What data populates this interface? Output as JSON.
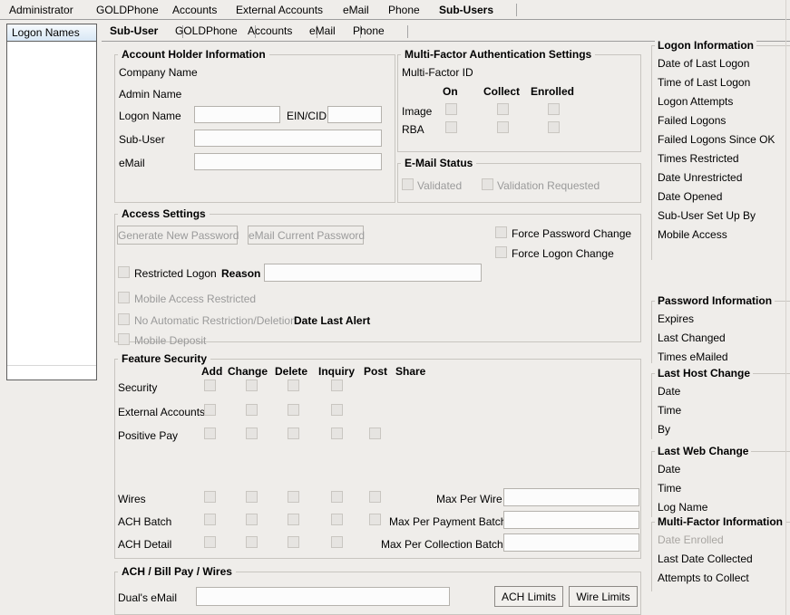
{
  "window": {
    "background_color": "#efedea",
    "accent_color": "#d8e7f5"
  },
  "top_tabs": [
    {
      "label": "Administrator",
      "selected": false
    },
    {
      "label": "GOLDPhone",
      "selected": false
    },
    {
      "label": "Accounts",
      "selected": false
    },
    {
      "label": "External Accounts",
      "selected": false
    },
    {
      "label": "eMail",
      "selected": false
    },
    {
      "label": "Phone",
      "selected": false
    },
    {
      "label": "Sub-Users",
      "selected": true
    }
  ],
  "sub_tabs": [
    {
      "label": "Sub-User",
      "selected": true
    },
    {
      "label": "GOLDPhone",
      "selected": false
    },
    {
      "label": "Accounts",
      "selected": false
    },
    {
      "label": "eMail",
      "selected": false
    },
    {
      "label": "Phone",
      "selected": false
    }
  ],
  "logon_list": {
    "header": "Logon Names",
    "rows": [
      "",
      "",
      "",
      "",
      "",
      "",
      "",
      "",
      "",
      "",
      "",
      "",
      "",
      "",
      "",
      "",
      "",
      "",
      "",
      "",
      ""
    ]
  },
  "account_holder": {
    "title": "Account Holder Information",
    "company_name_label": "Company Name",
    "company_name_value": "",
    "admin_name_label": "Admin Name",
    "admin_name_value": "",
    "logon_name_label": "Logon Name",
    "logon_name_value": "",
    "ein_cid_label": "EIN/CID",
    "ein_cid_value": "",
    "sub_user_label": "Sub-User",
    "sub_user_value": "",
    "email_label": "eMail",
    "email_value": ""
  },
  "mfa": {
    "title": "Multi-Factor Authentication Settings",
    "multi_factor_id_label": "Multi-Factor ID",
    "multi_factor_id_value": "",
    "columns": [
      "On",
      "Collect",
      "Enrolled"
    ],
    "rows": [
      {
        "label": "Image",
        "on": false,
        "collect": false,
        "enrolled": false
      },
      {
        "label": "RBA",
        "on": false,
        "collect": false,
        "enrolled": false
      }
    ]
  },
  "email_status": {
    "title": "E-Mail Status",
    "validated_label": "Validated",
    "validated_checked": false,
    "validation_requested_label": "Validation Requested",
    "validation_requested_checked": false
  },
  "access_settings": {
    "title": "Access Settings",
    "generate_password_button": "Generate New Password",
    "email_password_button": "eMail Current Password",
    "force_password_change_label": "Force Password Change",
    "force_password_change_checked": false,
    "force_logon_change_label": "Force Logon Change",
    "force_logon_change_checked": false,
    "restricted_logon_label": "Restricted Logon",
    "restricted_logon_checked": false,
    "reason_label": "Reason",
    "reason_value": "",
    "mobile_access_restricted_label": "Mobile Access Restricted",
    "mobile_access_restricted_checked": false,
    "no_auto_restriction_label": "No Automatic Restriction/Deletion",
    "no_auto_restriction_checked": false,
    "date_last_alert_label": "Date Last Alert",
    "date_last_alert_value": "",
    "mobile_deposit_label": "Mobile Deposit",
    "mobile_deposit_checked": false
  },
  "feature_security": {
    "title": "Feature Security",
    "columns": [
      "Add",
      "Change",
      "Delete",
      "Inquiry",
      "Post",
      "Share"
    ],
    "rows": [
      {
        "label": "Security",
        "cells": [
          false,
          false,
          false,
          false,
          null,
          null
        ]
      },
      {
        "label": "External Accounts",
        "cells": [
          false,
          false,
          false,
          false,
          null,
          null
        ]
      },
      {
        "label": "Positive Pay",
        "cells": [
          false,
          false,
          false,
          false,
          false,
          null
        ]
      },
      {
        "label": "Wires",
        "cells": [
          false,
          false,
          false,
          false,
          false,
          null
        ]
      },
      {
        "label": "ACH Batch",
        "cells": [
          false,
          false,
          false,
          false,
          false,
          null
        ]
      },
      {
        "label": "ACH Detail",
        "cells": [
          false,
          false,
          false,
          false,
          null,
          null
        ]
      }
    ],
    "max_per_wire_label": "Max Per Wire",
    "max_per_wire_value": "",
    "max_per_payment_batch_label": "Max Per Payment Batch",
    "max_per_payment_batch_value": "",
    "max_per_collection_batch_label": "Max Per Collection Batch",
    "max_per_collection_batch_value": ""
  },
  "ach_billpay_wires": {
    "title": "ACH / Bill Pay / Wires",
    "duals_email_label": "Dual's eMail",
    "duals_email_value": "",
    "ach_limits_button": "ACH Limits",
    "wire_limits_button": "Wire Limits"
  },
  "right_panel": {
    "groups": [
      {
        "title": "Logon Information",
        "rows": [
          {
            "label": "Date of Last Logon",
            "value": "",
            "disabled": false
          },
          {
            "label": "Time of Last Logon",
            "value": "",
            "disabled": false
          },
          {
            "label": "Logon Attempts",
            "value": "",
            "disabled": false
          },
          {
            "label": "Failed Logons",
            "value": "",
            "disabled": false
          },
          {
            "label": "Failed Logons Since OK",
            "value": "",
            "disabled": false
          },
          {
            "label": "Times Restricted",
            "value": "",
            "disabled": false
          },
          {
            "label": "Date Unrestricted",
            "value": "",
            "disabled": false
          },
          {
            "label": "Date Opened",
            "value": "",
            "disabled": false
          },
          {
            "label": "Sub-User Set Up By",
            "value": "",
            "disabled": false
          },
          {
            "label": "Mobile Access",
            "value": "",
            "disabled": false
          }
        ]
      },
      {
        "title": "Password Information",
        "rows": [
          {
            "label": "Expires",
            "value": "",
            "disabled": false
          },
          {
            "label": "Last Changed",
            "value": "",
            "disabled": false
          },
          {
            "label": "Times eMailed",
            "value": "",
            "disabled": false
          }
        ]
      },
      {
        "title": "Last Host Change",
        "rows": [
          {
            "label": "Date",
            "value": "",
            "disabled": false
          },
          {
            "label": "Time",
            "value": "",
            "disabled": false
          },
          {
            "label": "By",
            "value": "",
            "disabled": false
          }
        ]
      },
      {
        "title": "Last Web Change",
        "rows": [
          {
            "label": "Date",
            "value": "",
            "disabled": false
          },
          {
            "label": "Time",
            "value": "",
            "disabled": false
          },
          {
            "label": "Log Name",
            "value": "",
            "disabled": false
          }
        ]
      },
      {
        "title": "Multi-Factor Information",
        "rows": [
          {
            "label": "Date Enrolled",
            "value": "",
            "disabled": true
          },
          {
            "label": "Last Date Collected",
            "value": "",
            "disabled": false
          },
          {
            "label": "Attempts to Collect",
            "value": "",
            "disabled": false
          }
        ]
      }
    ]
  }
}
